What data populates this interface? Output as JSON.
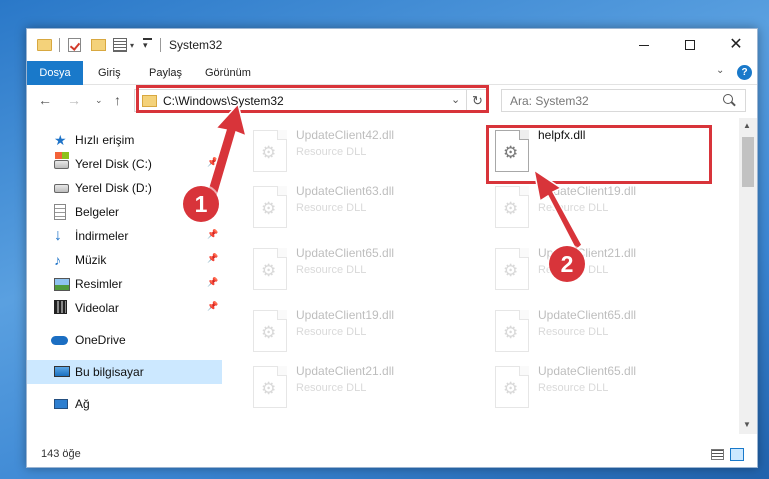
{
  "window": {
    "title": "System32",
    "ribbon_tabs": [
      "Dosya",
      "Giriş",
      "Paylaş",
      "Görünüm"
    ],
    "help": "?"
  },
  "address": {
    "path": "C:\\Windows\\System32",
    "search_placeholder": "Ara: System32"
  },
  "sidebar": {
    "items": [
      {
        "label": "Hızlı erişim"
      },
      {
        "label": "Yerel Disk (C:)"
      },
      {
        "label": "Yerel Disk (D:)"
      },
      {
        "label": "Belgeler"
      },
      {
        "label": "İndirmeler"
      },
      {
        "label": "Müzik"
      },
      {
        "label": "Resimler"
      },
      {
        "label": "Videolar"
      },
      {
        "label": "OneDrive"
      },
      {
        "label": "Bu bilgisayar"
      },
      {
        "label": "Ağ"
      }
    ],
    "selected": "Bu bilgisayar"
  },
  "files": [
    {
      "name": "UpdateClient42.dll",
      "type": "Resource DLL"
    },
    {
      "name": "helpfx.dll",
      "type": ""
    },
    {
      "name": "UpdateClient63.dll",
      "type": "Resource DLL"
    },
    {
      "name": "UpdateClient19.dll",
      "type": "Resource DLL"
    },
    {
      "name": "UpdateClient65.dll",
      "type": "Resource DLL"
    },
    {
      "name": "UpdateClient21.dll",
      "type": "Resource DLL"
    },
    {
      "name": "UpdateClient19.dll",
      "type": "Resource DLL"
    },
    {
      "name": "UpdateClient65.dll",
      "type": "Resource DLL"
    },
    {
      "name": "UpdateClient21.dll",
      "type": "Resource DLL"
    },
    {
      "name": "UpdateClient65.dll",
      "type": "Resource DLL"
    }
  ],
  "status": {
    "count": "143 öğe"
  },
  "callouts": {
    "one": "1",
    "two": "2"
  },
  "colors": {
    "accent": "#1979ca",
    "highlight": "#d8343a",
    "selected_bg": "#cce8ff"
  }
}
